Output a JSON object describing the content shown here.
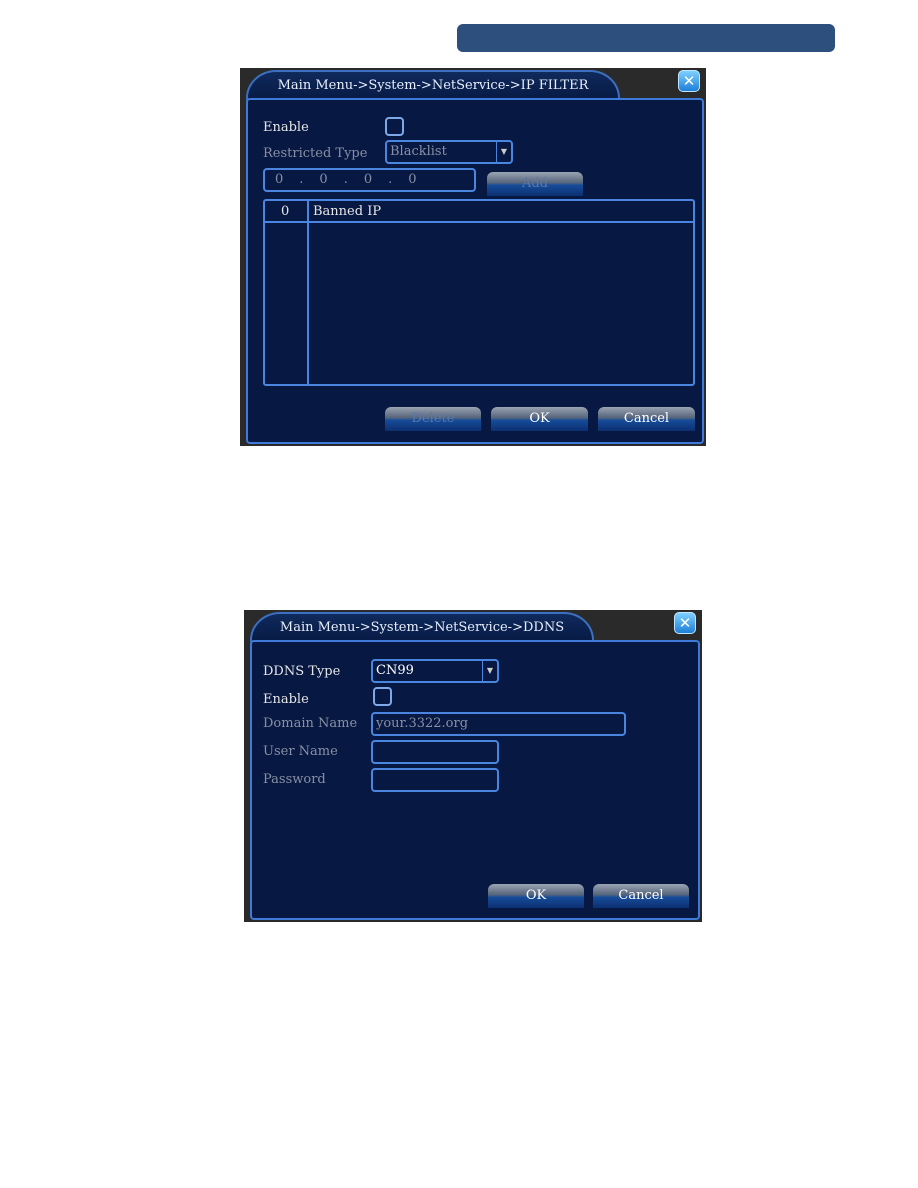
{
  "ip_filter": {
    "title": "Main Menu->System->NetService->IP FILTER",
    "enable_label": "Enable",
    "enable_checked": false,
    "restricted_type_label": "Restricted Type",
    "restricted_type_value": "Blacklist",
    "ip_octets": [
      "0",
      "0",
      "0",
      "0"
    ],
    "ip_sep": ".",
    "add_label": "Add",
    "table": {
      "index_header": "0",
      "col_header": "Banned IP",
      "rows": []
    },
    "delete_label": "Delete",
    "ok_label": "OK",
    "cancel_label": "Cancel"
  },
  "ddns": {
    "title": "Main Menu->System->NetService->DDNS",
    "type_label": "DDNS Type",
    "type_value": "CN99",
    "enable_label": "Enable",
    "enable_checked": false,
    "domain_label": "Domain Name",
    "domain_value": "your.3322.org",
    "user_label": "User Name",
    "user_value": "",
    "password_label": "Password",
    "password_value": "",
    "ok_label": "OK",
    "cancel_label": "Cancel"
  },
  "colors": {
    "accent": "#3e7ad8",
    "panel": "#071843",
    "header_bar": "#2d4f7d"
  }
}
